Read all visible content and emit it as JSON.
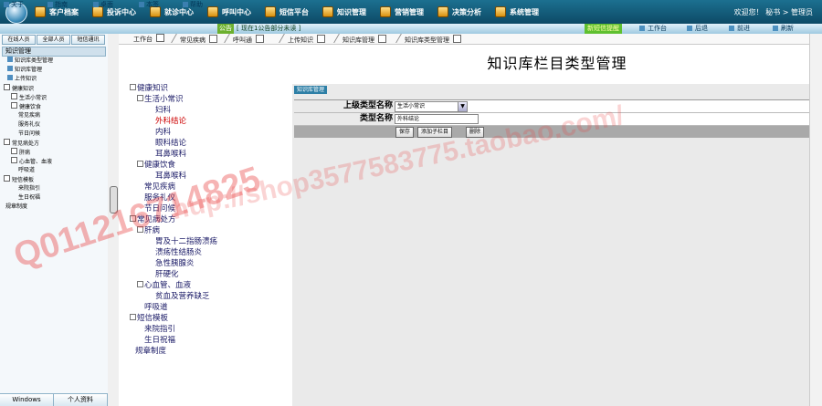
{
  "topnav": {
    "items": [
      {
        "label": "客户档案"
      },
      {
        "label": "投诉中心"
      },
      {
        "label": "就诊中心"
      },
      {
        "label": "呼叫中心"
      },
      {
        "label": "短信平台"
      },
      {
        "label": "知识管理"
      },
      {
        "label": "营销管理"
      },
      {
        "label": "决策分析"
      },
      {
        "label": "系统管理"
      }
    ],
    "welcome": "欢迎您！ 秘书 > 管理员"
  },
  "toolbar": {
    "items": [
      {
        "label": "关于"
      },
      {
        "label": "指南"
      },
      {
        "label": "桌面"
      },
      {
        "label": "本签"
      },
      {
        "label": "帮助"
      }
    ],
    "notice_badge": "公告",
    "notice": "[ 现在1公告部分未读 ]",
    "alert": "新短信提醒",
    "right_items": [
      {
        "label": "工作台"
      },
      {
        "label": "后退"
      },
      {
        "label": "前进"
      },
      {
        "label": "刷新"
      }
    ]
  },
  "sidebar": {
    "tabs": [
      {
        "label": "在线人员"
      },
      {
        "label": "全部人员"
      },
      {
        "label": "短信通讯"
      }
    ],
    "header": "知识管理",
    "items": [
      {
        "label": "知识库类型管理"
      },
      {
        "label": "知识库管理"
      },
      {
        "label": "上传知识"
      },
      {
        "label": "健康知识"
      },
      {
        "label": "生活小常识"
      },
      {
        "label": "健康饮食"
      },
      {
        "label": "常见疾病"
      },
      {
        "label": "服务礼仪"
      },
      {
        "label": "节日问候"
      },
      {
        "label": "常见病处方"
      },
      {
        "label": "肝病"
      },
      {
        "label": "心血管、血液"
      },
      {
        "label": "呼吸道"
      },
      {
        "label": "短信模板"
      },
      {
        "label": "来院指引"
      },
      {
        "label": "生日祝福"
      },
      {
        "label": "规章制度"
      }
    ],
    "footer": [
      {
        "label": "Windows"
      },
      {
        "label": "个人资料"
      }
    ]
  },
  "content_tabs": [
    {
      "label": "工作台"
    },
    {
      "label": "常见疾病"
    },
    {
      "label": "呼叫通"
    },
    {
      "label": "上传知识"
    },
    {
      "label": "知识库管理"
    },
    {
      "label": "知识库类型管理"
    }
  ],
  "page_title": "知识库栏目类型管理",
  "tree": [
    {
      "label": "健康知识"
    },
    {
      "label": "生活小常识"
    },
    {
      "label": "妇科"
    },
    {
      "label": "外科结论"
    },
    {
      "label": "内科"
    },
    {
      "label": "眼科结论"
    },
    {
      "label": "耳鼻喉科"
    },
    {
      "label": "健康饮食"
    },
    {
      "label": "耳鼻喉科"
    },
    {
      "label": "常见疾病"
    },
    {
      "label": "服务礼仪"
    },
    {
      "label": "节日问候"
    },
    {
      "label": "常见病处方"
    },
    {
      "label": "肝病"
    },
    {
      "label": "胃及十二指肠溃疡"
    },
    {
      "label": "溃疡性结肠炎"
    },
    {
      "label": "急性胰腺炎"
    },
    {
      "label": "肝硬化"
    },
    {
      "label": "心血管、血液"
    },
    {
      "label": "贫血及营养缺乏"
    },
    {
      "label": "呼吸道"
    },
    {
      "label": "短信模板"
    },
    {
      "label": "来院指引"
    },
    {
      "label": "生日祝福"
    },
    {
      "label": "规章制度"
    }
  ],
  "form": {
    "tab": "知识库管理",
    "parent_label": "上级类型名称",
    "parent_value": "生活小常识",
    "name_label": "类型名称",
    "name_value": "外科结论",
    "save": "保存",
    "add_child": "添加子栏目",
    "delete": "删除"
  },
  "watermarks": [
    "Q011216714825",
    "hup://shop3577583775.taobao.com/"
  ]
}
